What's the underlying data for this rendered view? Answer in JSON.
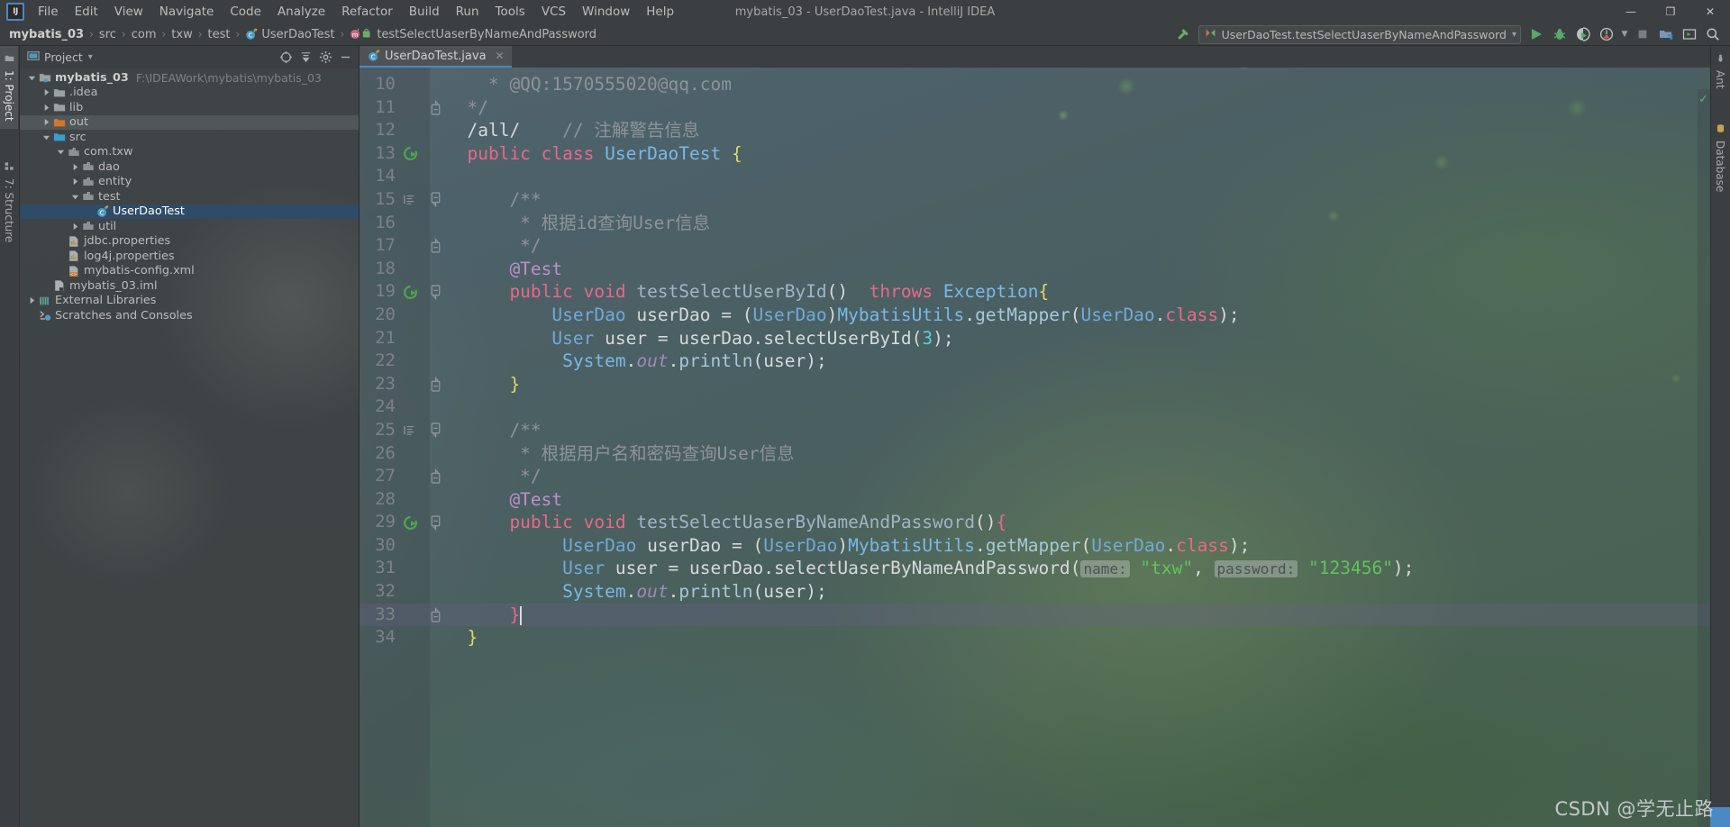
{
  "window": {
    "title": "mybatis_03 - UserDaoTest.java - IntelliJ IDEA",
    "minimize": "—",
    "maximize": "❐",
    "close": "✕"
  },
  "menu": {
    "items": [
      {
        "label": "File"
      },
      {
        "label": "Edit"
      },
      {
        "label": "View"
      },
      {
        "label": "Navigate"
      },
      {
        "label": "Code"
      },
      {
        "label": "Analyze"
      },
      {
        "label": "Refactor"
      },
      {
        "label": "Build"
      },
      {
        "label": "Run"
      },
      {
        "label": "Tools"
      },
      {
        "label": "VCS"
      },
      {
        "label": "Window"
      },
      {
        "label": "Help"
      }
    ]
  },
  "breadcrumb": {
    "items": [
      {
        "label": "mybatis_03",
        "icon": "none",
        "bold": true
      },
      {
        "label": "src",
        "icon": "none",
        "bold": false
      },
      {
        "label": "com",
        "icon": "none",
        "bold": false
      },
      {
        "label": "txw",
        "icon": "none",
        "bold": false
      },
      {
        "label": "test",
        "icon": "none",
        "bold": false
      },
      {
        "label": "UserDaoTest",
        "icon": "java-class-icon",
        "bold": false
      },
      {
        "label": "testSelectUaserByNameAndPassword",
        "icon": "method-icon",
        "bold": false
      }
    ],
    "separator": "›"
  },
  "toolbar": {
    "run_configuration": "UserDaoTest.testSelectUaserByNameAndPassword",
    "run_config_dropdown": "▾",
    "icons": [
      {
        "name": "build-hammer-icon",
        "glyph": "hammer"
      },
      {
        "name": "run-icon",
        "glyph": "play"
      },
      {
        "name": "debug-icon",
        "glyph": "bug"
      },
      {
        "name": "run-with-coverage-icon",
        "glyph": "coverage"
      },
      {
        "name": "profiler-icon",
        "glyph": "profiler"
      },
      {
        "name": "stop-icon",
        "glyph": "stop"
      },
      {
        "name": "project-structure-icon",
        "glyph": "structure"
      },
      {
        "name": "layout-icon",
        "glyph": "layout"
      },
      {
        "name": "search-icon",
        "glyph": "search"
      }
    ]
  },
  "left_tool_strip": {
    "tabs": [
      {
        "label": "1: Project",
        "active": true,
        "icon": "project-folder-icon"
      },
      {
        "label": "7: Structure",
        "active": false,
        "icon": "structure-icon"
      }
    ]
  },
  "right_tool_strip": {
    "tabs": [
      {
        "label": "Ant",
        "icon": "ant-icon"
      },
      {
        "label": "Database",
        "icon": "database-icon"
      }
    ]
  },
  "project_panel": {
    "title": "Project",
    "dropdown": "▾",
    "tools": [
      {
        "name": "scroll-from-source-icon",
        "glyph": "target"
      },
      {
        "name": "collapse-all-icon",
        "glyph": "collapse"
      },
      {
        "name": "settings-gear-icon",
        "glyph": "gear"
      },
      {
        "name": "hide-panel-icon",
        "glyph": "minus"
      }
    ],
    "tree": [
      {
        "label": "mybatis_03",
        "sub": "F:\\IDEAWork\\mybatis\\mybatis_03",
        "depth": 0,
        "arrow": "down",
        "icon": "module-folder-icon",
        "bold": true,
        "state": "normal"
      },
      {
        "label": ".idea",
        "sub": "",
        "depth": 1,
        "arrow": "right",
        "icon": "folder-icon",
        "bold": false,
        "state": "normal"
      },
      {
        "label": "lib",
        "sub": "",
        "depth": 1,
        "arrow": "right",
        "icon": "folder-icon",
        "bold": false,
        "state": "normal"
      },
      {
        "label": "out",
        "sub": "",
        "depth": 1,
        "arrow": "right",
        "icon": "folder-orange-icon",
        "bold": false,
        "state": "hover"
      },
      {
        "label": "src",
        "sub": "",
        "depth": 1,
        "arrow": "down",
        "icon": "folder-source-icon",
        "bold": false,
        "state": "normal"
      },
      {
        "label": "com.txw",
        "sub": "",
        "depth": 2,
        "arrow": "down",
        "icon": "package-icon",
        "bold": false,
        "state": "normal"
      },
      {
        "label": "dao",
        "sub": "",
        "depth": 3,
        "arrow": "right",
        "icon": "package-icon",
        "bold": false,
        "state": "normal"
      },
      {
        "label": "entity",
        "sub": "",
        "depth": 3,
        "arrow": "right",
        "icon": "package-icon",
        "bold": false,
        "state": "normal"
      },
      {
        "label": "test",
        "sub": "",
        "depth": 3,
        "arrow": "down",
        "icon": "package-icon",
        "bold": false,
        "state": "normal"
      },
      {
        "label": "UserDaoTest",
        "sub": "",
        "depth": 4,
        "arrow": "none",
        "icon": "java-test-class-icon",
        "bold": false,
        "state": "selected"
      },
      {
        "label": "util",
        "sub": "",
        "depth": 3,
        "arrow": "right",
        "icon": "package-icon",
        "bold": false,
        "state": "normal"
      },
      {
        "label": "jdbc.properties",
        "sub": "",
        "depth": 2,
        "arrow": "none",
        "icon": "properties-icon",
        "bold": false,
        "state": "normal"
      },
      {
        "label": "log4j.properties",
        "sub": "",
        "depth": 2,
        "arrow": "none",
        "icon": "properties-icon",
        "bold": false,
        "state": "normal"
      },
      {
        "label": "mybatis-config.xml",
        "sub": "",
        "depth": 2,
        "arrow": "none",
        "icon": "xml-icon",
        "bold": false,
        "state": "normal"
      },
      {
        "label": "mybatis_03.iml",
        "sub": "",
        "depth": 1,
        "arrow": "none",
        "icon": "iml-icon",
        "bold": false,
        "state": "normal"
      },
      {
        "label": "External Libraries",
        "sub": "",
        "depth": 0,
        "arrow": "right",
        "icon": "libraries-icon",
        "bold": false,
        "state": "normal"
      },
      {
        "label": "Scratches and Consoles",
        "sub": "",
        "depth": 0,
        "arrow": "none",
        "icon": "scratches-icon",
        "bold": false,
        "state": "normal"
      }
    ]
  },
  "editor": {
    "tabs": [
      {
        "label": "UserDaoTest.java",
        "icon": "java-test-class-icon",
        "active": true,
        "close": "✕"
      }
    ],
    "inspection_status": "✓",
    "lines": [
      {
        "no": "10",
        "gutter": "",
        "fold": "",
        "current": false,
        "tokens": [
          {
            "t": "    * @QQ:1570555020@qq.com",
            "c": "cmt"
          }
        ]
      },
      {
        "no": "11",
        "gutter": "",
        "fold": "end",
        "current": false,
        "tokens": [
          {
            "t": "  */",
            "c": "cmt"
          }
        ]
      },
      {
        "no": "12",
        "gutter": "",
        "fold": "",
        "current": false,
        "tokens": [
          {
            "t": "  /all/",
            "c": "punc"
          },
          {
            "t": "    // 注解警告信息",
            "c": "cmt"
          }
        ]
      },
      {
        "no": "13",
        "gutter": "run-class",
        "fold": "",
        "current": false,
        "tokens": [
          {
            "t": "  public class ",
            "c": "kw2"
          },
          {
            "t": "UserDaoTest",
            "c": "type2"
          },
          {
            "t": " {",
            "c": "brace-y"
          }
        ]
      },
      {
        "no": "14",
        "gutter": "",
        "fold": "",
        "current": false,
        "tokens": []
      },
      {
        "no": "15",
        "gutter": "struct",
        "fold": "start",
        "current": false,
        "tokens": [
          {
            "t": "      /**",
            "c": "cmt"
          }
        ]
      },
      {
        "no": "16",
        "gutter": "",
        "fold": "",
        "current": false,
        "tokens": [
          {
            "t": "       * 根据id查询User信息",
            "c": "cmt"
          }
        ]
      },
      {
        "no": "17",
        "gutter": "",
        "fold": "end",
        "current": false,
        "tokens": [
          {
            "t": "       */",
            "c": "cmt"
          }
        ]
      },
      {
        "no": "18",
        "gutter": "",
        "fold": "",
        "current": false,
        "tokens": [
          {
            "t": "      @Test",
            "c": "anno"
          }
        ]
      },
      {
        "no": "19",
        "gutter": "run-method",
        "fold": "start",
        "current": false,
        "tokens": [
          {
            "t": "      public void ",
            "c": "kw2"
          },
          {
            "t": "testSelectUserById",
            "c": "method"
          },
          {
            "t": "()",
            "c": "punc"
          },
          {
            "t": "  ",
            "c": "punc"
          },
          {
            "t": "throws ",
            "c": "kw2"
          },
          {
            "t": "Exception",
            "c": "type2"
          },
          {
            "t": "{",
            "c": "brace-y"
          }
        ]
      },
      {
        "no": "20",
        "gutter": "",
        "fold": "",
        "current": false,
        "tokens": [
          {
            "t": "          ",
            "c": "punc"
          },
          {
            "t": "UserDao",
            "c": "type"
          },
          {
            "t": " userDao = ",
            "c": "ident"
          },
          {
            "t": "(",
            "c": "punc"
          },
          {
            "t": "UserDao",
            "c": "type"
          },
          {
            "t": ")",
            "c": "punc"
          },
          {
            "t": "MybatisUtils",
            "c": "type2"
          },
          {
            "t": ".",
            "c": "punc"
          },
          {
            "t": "getMapper",
            "c": "methodc"
          },
          {
            "t": "(",
            "c": "punc"
          },
          {
            "t": "UserDao",
            "c": "type"
          },
          {
            "t": ".",
            "c": "punc"
          },
          {
            "t": "class",
            "c": "kw2"
          },
          {
            "t": ");",
            "c": "punc"
          }
        ]
      },
      {
        "no": "21",
        "gutter": "",
        "fold": "",
        "current": false,
        "tokens": [
          {
            "t": "          ",
            "c": "punc"
          },
          {
            "t": "User",
            "c": "type"
          },
          {
            "t": " user = userDao.",
            "c": "ident"
          },
          {
            "t": "selectUserById",
            "c": "ident"
          },
          {
            "t": "(",
            "c": "punc"
          },
          {
            "t": "3",
            "c": "num"
          },
          {
            "t": ");",
            "c": "punc"
          }
        ]
      },
      {
        "no": "22",
        "gutter": "",
        "fold": "",
        "current": false,
        "tokens": [
          {
            "t": "           ",
            "c": "punc"
          },
          {
            "t": "System",
            "c": "type2"
          },
          {
            "t": ".",
            "c": "punc"
          },
          {
            "t": "out",
            "c": "static"
          },
          {
            "t": ".",
            "c": "punc"
          },
          {
            "t": "println",
            "c": "methodc"
          },
          {
            "t": "(user);",
            "c": "punc"
          }
        ]
      },
      {
        "no": "23",
        "gutter": "",
        "fold": "end",
        "current": false,
        "tokens": [
          {
            "t": "      }",
            "c": "brace-y"
          }
        ]
      },
      {
        "no": "24",
        "gutter": "",
        "fold": "",
        "current": false,
        "tokens": []
      },
      {
        "no": "25",
        "gutter": "struct",
        "fold": "start",
        "current": false,
        "tokens": [
          {
            "t": "      /**",
            "c": "cmt"
          }
        ]
      },
      {
        "no": "26",
        "gutter": "",
        "fold": "",
        "current": false,
        "tokens": [
          {
            "t": "       * 根据用户名和密码查询User信息",
            "c": "cmt"
          }
        ]
      },
      {
        "no": "27",
        "gutter": "",
        "fold": "end",
        "current": false,
        "tokens": [
          {
            "t": "       */",
            "c": "cmt"
          }
        ]
      },
      {
        "no": "28",
        "gutter": "",
        "fold": "",
        "current": false,
        "tokens": [
          {
            "t": "      @Test",
            "c": "anno"
          }
        ]
      },
      {
        "no": "29",
        "gutter": "run-method",
        "fold": "start",
        "current": false,
        "tokens": [
          {
            "t": "      public void ",
            "c": "kw2"
          },
          {
            "t": "testSelectUaserByNameAndPassword",
            "c": "method"
          },
          {
            "t": "()",
            "c": "punc"
          },
          {
            "t": "{",
            "c": "brace-p"
          }
        ]
      },
      {
        "no": "30",
        "gutter": "",
        "fold": "",
        "current": false,
        "tokens": [
          {
            "t": "           ",
            "c": "punc"
          },
          {
            "t": "UserDao",
            "c": "type"
          },
          {
            "t": " userDao = ",
            "c": "ident"
          },
          {
            "t": "(",
            "c": "punc"
          },
          {
            "t": "UserDao",
            "c": "type"
          },
          {
            "t": ")",
            "c": "punc"
          },
          {
            "t": "MybatisUtils",
            "c": "type2"
          },
          {
            "t": ".",
            "c": "punc"
          },
          {
            "t": "getMapper",
            "c": "methodc"
          },
          {
            "t": "(",
            "c": "punc"
          },
          {
            "t": "UserDao",
            "c": "type"
          },
          {
            "t": ".",
            "c": "punc"
          },
          {
            "t": "class",
            "c": "kw2"
          },
          {
            "t": ");",
            "c": "punc"
          }
        ]
      },
      {
        "no": "31",
        "gutter": "",
        "fold": "",
        "current": false,
        "tokens": [
          {
            "t": "           ",
            "c": "punc"
          },
          {
            "t": "User",
            "c": "type"
          },
          {
            "t": " user = userDao.",
            "c": "ident"
          },
          {
            "t": "selectUaserByNameAndPassword",
            "c": "ident"
          },
          {
            "t": "(",
            "c": "punc"
          },
          {
            "t": "name:",
            "c": "hint"
          },
          {
            "t": " ",
            "c": "punc"
          },
          {
            "t": "\"txw\"",
            "c": "str"
          },
          {
            "t": ", ",
            "c": "punc"
          },
          {
            "t": "password:",
            "c": "hint"
          },
          {
            "t": " ",
            "c": "punc"
          },
          {
            "t": "\"123456\"",
            "c": "str"
          },
          {
            "t": ");",
            "c": "punc"
          }
        ]
      },
      {
        "no": "32",
        "gutter": "",
        "fold": "",
        "current": false,
        "tokens": [
          {
            "t": "           ",
            "c": "punc"
          },
          {
            "t": "System",
            "c": "type2"
          },
          {
            "t": ".",
            "c": "punc"
          },
          {
            "t": "out",
            "c": "static"
          },
          {
            "t": ".",
            "c": "punc"
          },
          {
            "t": "println",
            "c": "methodc"
          },
          {
            "t": "(user);",
            "c": "punc"
          }
        ]
      },
      {
        "no": "33",
        "gutter": "",
        "fold": "end",
        "current": true,
        "tokens": [
          {
            "t": "      }",
            "c": "brace-p"
          }
        ]
      },
      {
        "no": "34",
        "gutter": "",
        "fold": "",
        "current": false,
        "tokens": [
          {
            "t": "  }",
            "c": "brace-y"
          }
        ]
      }
    ]
  },
  "watermark": {
    "text": "CSDN @学无止路"
  }
}
